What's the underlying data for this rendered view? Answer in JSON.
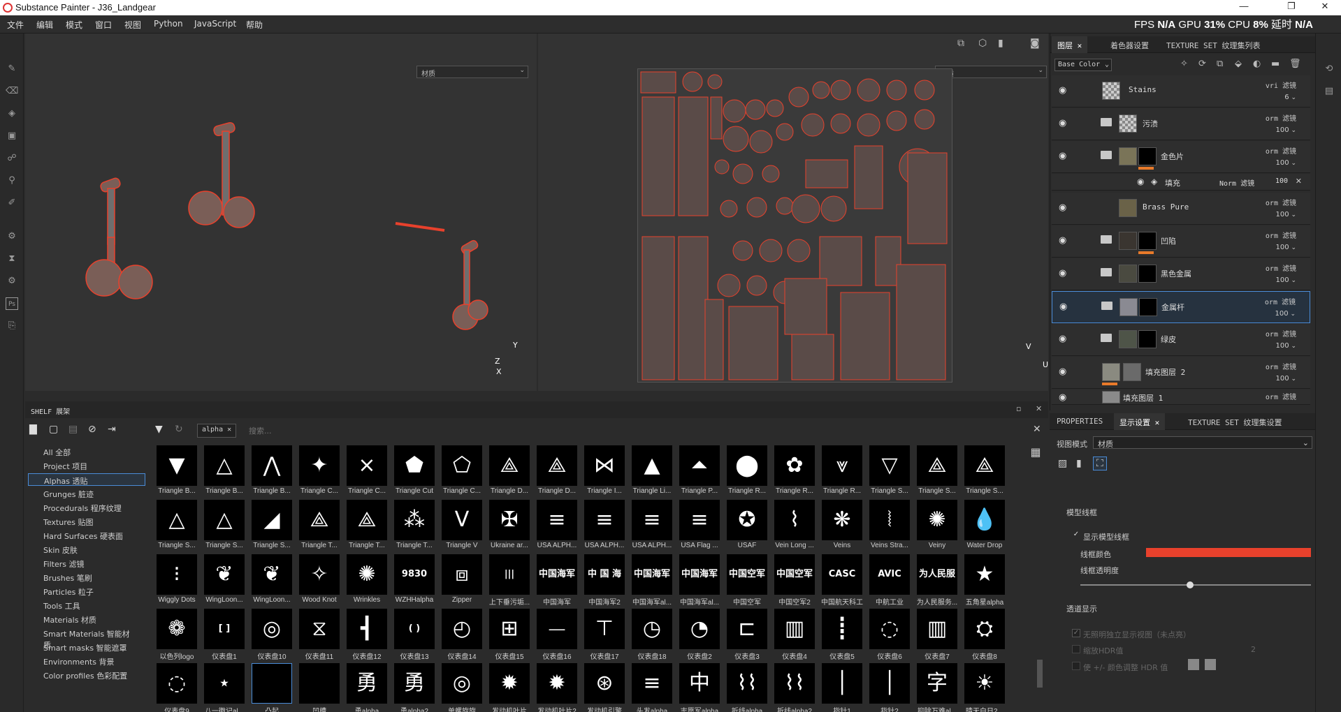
{
  "window": {
    "title": "Substance Painter - J36_Landgear",
    "min": "—",
    "restore": "❐",
    "close": "✕"
  },
  "menu": [
    "文件",
    "编辑",
    "模式",
    "窗口",
    "视图",
    "Python",
    "JavaScript",
    "帮助"
  ],
  "stats": {
    "fps_label": "FPS",
    "fps_value": "N/A",
    "gpu_label": "GPU",
    "gpu_value": "31%",
    "cpu_label": "CPU",
    "cpu_value": "8%",
    "latency_label": "延时",
    "latency_value": "N/A"
  },
  "viewport": {
    "left_mode": "材质",
    "right_mode": "材质",
    "axis_y": "Y",
    "axis_z": "Z",
    "axis_x": "X",
    "axis_v": "V",
    "axis_u": "U"
  },
  "right_tabs": [
    {
      "label": "图层"
    },
    {
      "label": "着色器设置"
    },
    {
      "label": "TEXTURE SET 纹理集列表"
    }
  ],
  "channel": {
    "value": "Base Color"
  },
  "layers": [
    {
      "name": "Stains",
      "blend": "vri 滤镜",
      "opacity": "6"
    },
    {
      "name": "污渍",
      "blend": "orm 滤镜",
      "opacity": "100"
    },
    {
      "name": "金色片",
      "blend": "orm 滤镜",
      "opacity": "100"
    },
    {
      "name": "填充",
      "blend": "Norm 滤镜",
      "opacity": "100"
    },
    {
      "name": "Brass Pure",
      "blend": "orm 滤镜",
      "opacity": "100"
    },
    {
      "name": "凹陷",
      "blend": "orm 滤镜",
      "opacity": "100"
    },
    {
      "name": "黑色金属",
      "blend": "orm 滤镜",
      "opacity": "100"
    },
    {
      "name": "金属杆",
      "blend": "orm 滤镜",
      "opacity": "100"
    },
    {
      "name": "绿皮",
      "blend": "orm 滤镜",
      "opacity": "100"
    },
    {
      "name": "填充图层 2",
      "blend": "orm 滤镜",
      "opacity": "100"
    },
    {
      "name": "填充图层 1",
      "blend": "orm 滤镜",
      "opacity": ""
    }
  ],
  "shelf": {
    "title": "SHELF 展架",
    "filter_tag": "alpha",
    "search_placeholder": "搜索...",
    "categories": [
      "All 全部",
      "Project 项目",
      "Alphas 透贴",
      "Grunges 脏迹",
      "Procedurals 程序纹理",
      "Textures 贴图",
      "Hard Surfaces 硬表面",
      "Skin 皮肤",
      "Filters 滤镜",
      "Brushes 笔刷",
      "Particles 粒子",
      "Tools 工具",
      "Materials 材质",
      "Smart Materials 智能材质",
      "Smart masks 智能遮罩",
      "Environments 背景",
      "Color profiles 色彩配置"
    ],
    "tiles": [
      [
        "Triangle B...",
        "Triangle B...",
        "Triangle B...",
        "Triangle C...",
        "Triangle C...",
        "Triangle Cut",
        "Triangle C...",
        "Triangle D...",
        "Triangle D...",
        "Triangle I...",
        "Triangle Li...",
        "Triangle P...",
        "Triangle R...",
        "Triangle R...",
        "Triangle R...",
        "Triangle S...",
        "Triangle S...",
        "Triangle S..."
      ],
      [
        "Triangle S...",
        "Triangle S...",
        "Triangle S...",
        "Triangle T...",
        "Triangle T...",
        "Triangle T...",
        "Triangle V",
        "Ukraine ar...",
        "USA ALPH...",
        "USA ALPH...",
        "USA ALPH...",
        "USA Flag ...",
        "USAF",
        "Vein Long ...",
        "Veins",
        "Veins Stra...",
        "Veiny",
        "Water Drop"
      ],
      [
        "Wiggly Dots",
        "WingLoon...",
        "WingLoon...",
        "Wood Knot",
        "Wrinkles",
        "WZHHalpha",
        "Zipper",
        "上下垂污垢...",
        "中国海军",
        "中国海军2",
        "中国海军al...",
        "中国海军al...",
        "中国空军",
        "中国空军2",
        "中国航天科工",
        "中航工业",
        "为人民服务...",
        "五角星alpha"
      ],
      [
        "以色列logo",
        "仪表盘1",
        "仪表盘10",
        "仪表盘11",
        "仪表盘12",
        "仪表盘13",
        "仪表盘14",
        "仪表盘15",
        "仪表盘16",
        "仪表盘17",
        "仪表盘18",
        "仪表盘2",
        "仪表盘3",
        "仪表盘4",
        "仪表盘5",
        "仪表盘6",
        "仪表盘7",
        "仪表盘8"
      ],
      [
        "仪表盘9",
        "八一徽记al...",
        "凸起",
        "凹槽",
        "勇alpha",
        "勇alpha2",
        "单螺旋旋",
        "发动机叶片",
        "发动机叶片2",
        "发动机引擎",
        "头发alpha",
        "志愿军alpha",
        "折线alpha",
        "折线alpha2",
        "指针1",
        "指针2",
        "抑除万难al...",
        "晴天白日2..."
      ]
    ],
    "glyphs": [
      [
        "▼",
        "△",
        "⋀",
        "✦",
        "⨯",
        "⬟",
        "⬠",
        "⟁",
        "⟁",
        "⋈",
        "▲",
        "⏶",
        "⬤",
        "✿",
        "⩔",
        "▽",
        "⟁",
        "⟁"
      ],
      [
        "△",
        "△",
        "◢",
        "⟁",
        "⟁",
        "⁂",
        "V",
        "✠",
        "≡",
        "≡",
        "≡",
        "≡",
        "✪",
        "⌇",
        "❋",
        "⦚",
        "✺",
        "💧"
      ],
      [
        "⁝",
        "❦",
        "❦",
        "✧",
        "✺",
        "9830",
        "⧈",
        "|||",
        "中国海军",
        "中 国 海 军",
        "中国海军",
        "中国海军",
        "中国空军",
        "中国空军",
        "CASC",
        "AVIC",
        "为人民服务",
        "★"
      ],
      [
        "❁",
        "[ ]",
        "◎",
        "⧖",
        "┫",
        "( )",
        "◴",
        "⊞",
        "⏤",
        "⊤",
        "◷",
        "◔",
        "⊏",
        "▥",
        "┋",
        "◌",
        "▥",
        "⛭"
      ],
      [
        "◌",
        "⋆",
        "",
        "",
        "勇",
        "勇",
        "◎",
        "✹",
        "✹",
        "⊛",
        "≡",
        "中国",
        "⌇⌇",
        "⌇⌇",
        "│",
        "│",
        "字",
        "☀"
      ]
    ]
  },
  "properties": {
    "tabs": [
      {
        "label": "PROPERTIES"
      },
      {
        "label": "显示设置"
      },
      {
        "label": "TEXTURE SET 纹理集设置"
      }
    ],
    "view_mode_label": "视图模式",
    "view_mode_value": "材质",
    "section_wireframe": "模型线框",
    "show_wireframe": "显示模型线框",
    "wire_color": "线框颜色",
    "wire_opacity": "线框透明度",
    "wire_color_hex": "#e8412c",
    "section_alpha": "透道显示",
    "alpha_opt1": "无照明独立显示视图（未点亮）",
    "alpha_opt2": "缩放HDR值",
    "alpha_opt2_value": "2",
    "alpha_opt3": "使 +/- 颜色调整 HDR 值"
  },
  "colors": {
    "accent": "#4a8cd8",
    "wire": "#e8412c",
    "orange": "#e87a2a"
  }
}
